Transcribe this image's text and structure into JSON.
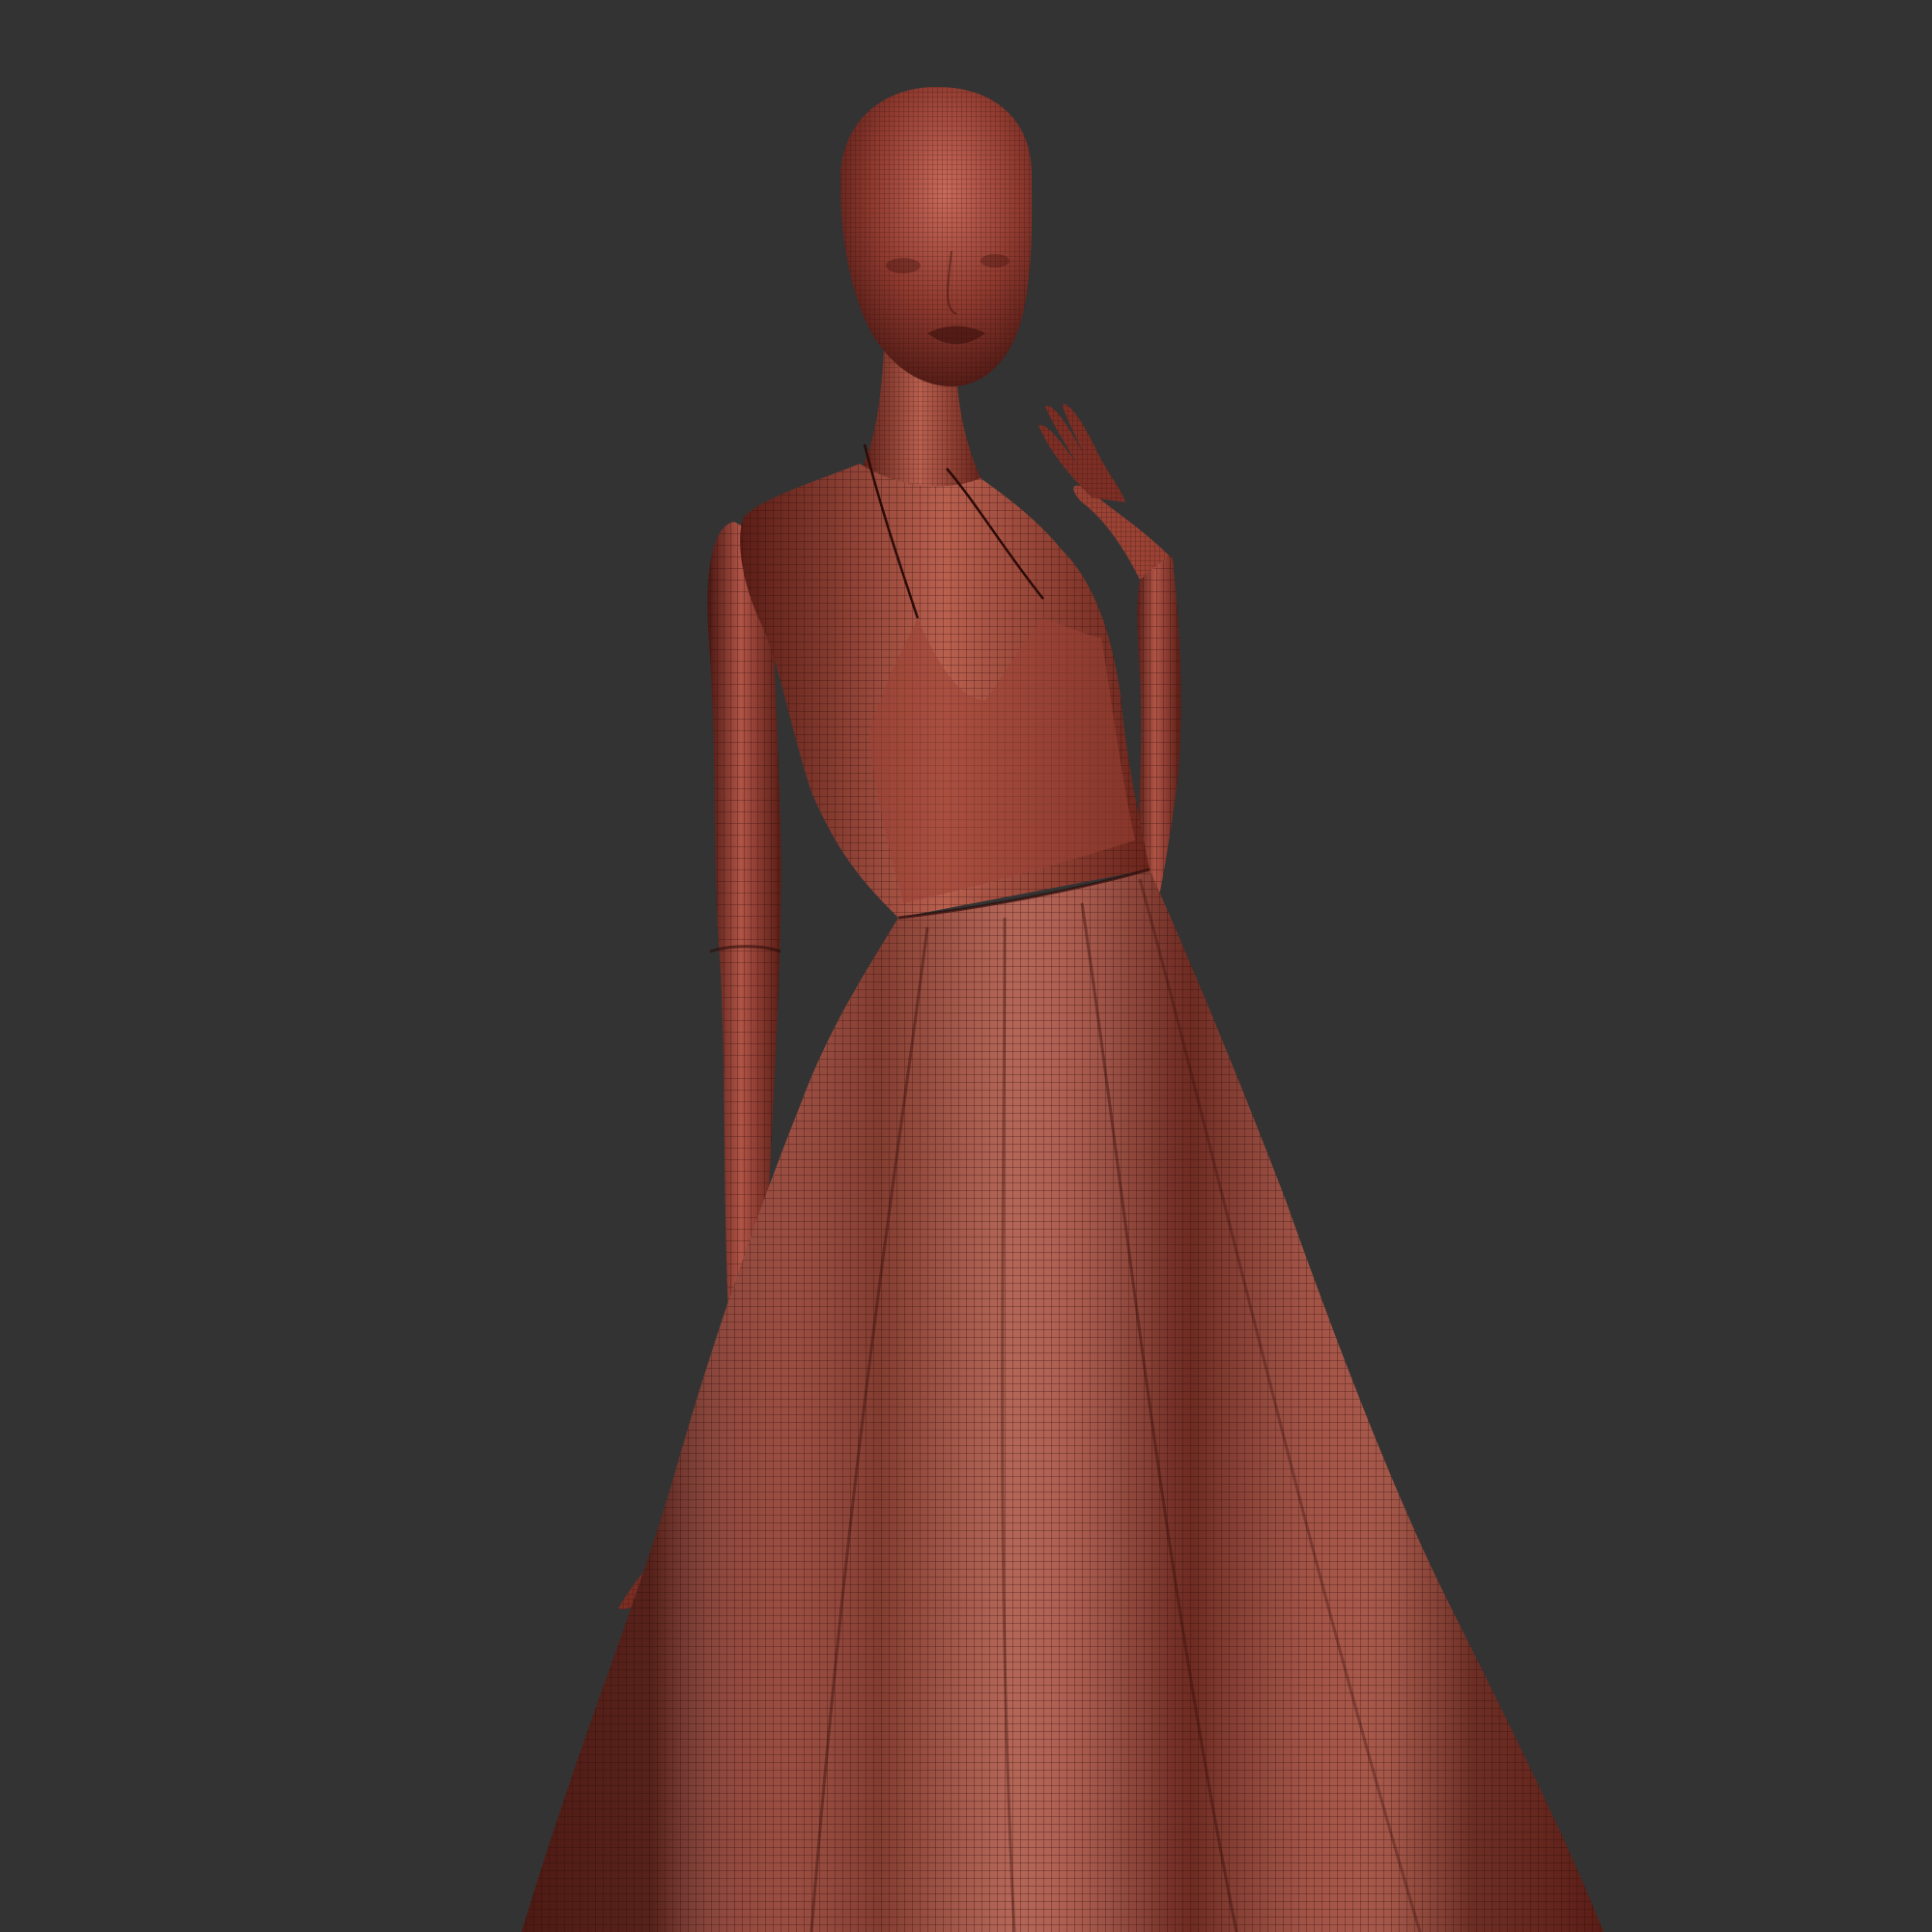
{
  "viewport": {
    "background_color": "#333333",
    "render_mode": "wireframe-on-shaded",
    "model": "mannequin-in-halter-dress"
  },
  "colors": {
    "base": "#8f3a2f",
    "highlight": "#c96a5b",
    "shadow": "#4a1712",
    "wire": "#2a0b08",
    "dress_base": "#8a3529"
  }
}
